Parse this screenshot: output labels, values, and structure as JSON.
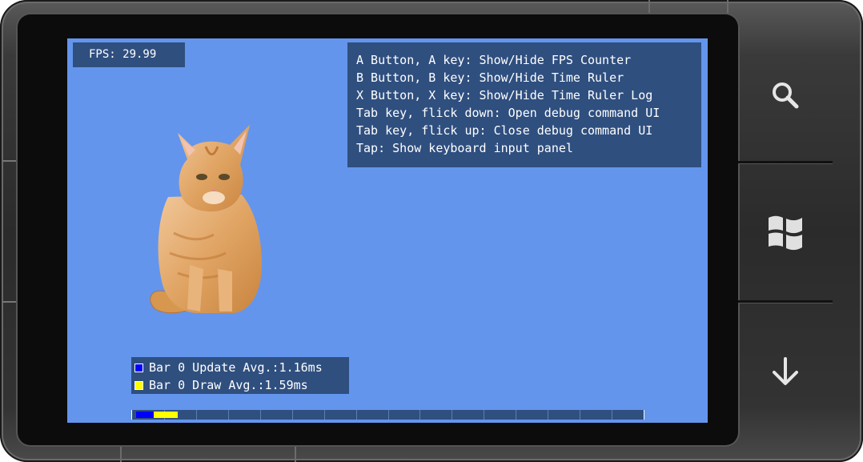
{
  "fps_counter": {
    "text": "FPS: 29.99"
  },
  "help_lines": [
    "A Button, A key: Show/Hide FPS Counter",
    "B Button, B key: Show/Hide Time Ruler",
    "X Button, X key: Show/Hide Time Ruler Log",
    "Tab key, flick down: Open debug command UI",
    "Tab key, flick up: Close debug command UI",
    "Tap: Show keyboard input panel"
  ],
  "time_ruler_log": [
    {
      "label": "Bar 0 Update Avg.:1.16ms",
      "color": "#0000ff",
      "avg_ms": 1.16
    },
    {
      "label": "Bar 0 Draw Avg.:1.59ms",
      "color": "#ffff00",
      "avg_ms": 1.59
    }
  ],
  "time_ruler": {
    "segments": 16,
    "bars": [
      {
        "name": "update",
        "color": "#0000ff",
        "start_ms": 0.0,
        "end_ms": 1.16
      },
      {
        "name": "draw",
        "color": "#ffff00",
        "start_ms": 1.16,
        "end_ms": 2.75
      }
    ],
    "frame_ms": 16.67
  },
  "hardware_buttons": [
    {
      "name": "search-icon"
    },
    {
      "name": "windows-start-icon"
    },
    {
      "name": "back-arrow-icon"
    }
  ],
  "colors": {
    "screen_background": "#6495ed",
    "panel_background": "#2f4f7f",
    "text": "#ffffff"
  }
}
